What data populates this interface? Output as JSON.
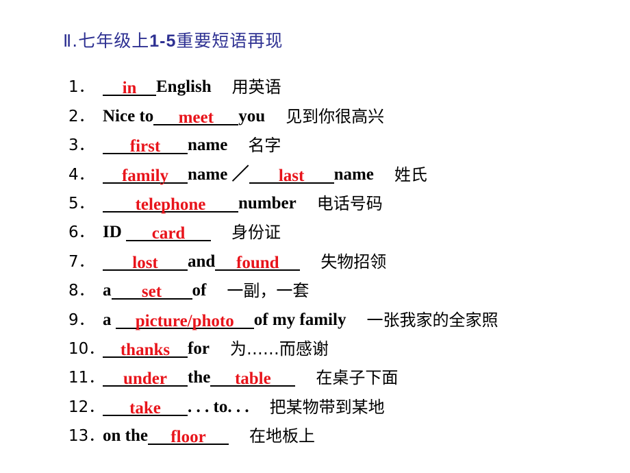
{
  "title": {
    "prefix": "Ⅱ.七年级上",
    "bold_part": "1-5",
    "suffix": "重要短语再现"
  },
  "colors": {
    "title": "#2e3192",
    "answer": "#e8141b",
    "text": "#000000"
  },
  "items": [
    {
      "num": "1．",
      "parts": [
        {
          "blank": "in"
        },
        {
          "text": "English"
        }
      ],
      "zh": "用英语"
    },
    {
      "num": "2．",
      "parts": [
        {
          "text": "Nice to"
        },
        {
          "blank": "meet"
        },
        {
          "text": "you"
        }
      ],
      "zh": "见到你很高兴"
    },
    {
      "num": "3．",
      "parts": [
        {
          "blank": "first"
        },
        {
          "text": "name"
        }
      ],
      "zh": "名字"
    },
    {
      "num": "4．",
      "parts": [
        {
          "blank": "family"
        },
        {
          "text": "name ／"
        },
        {
          "blank": "last"
        },
        {
          "text": "name"
        }
      ],
      "zh": "姓氏"
    },
    {
      "num": "5．",
      "parts": [
        {
          "blank": "telephone"
        },
        {
          "text": "number"
        }
      ],
      "zh": "电话号码"
    },
    {
      "num": "6．",
      "parts": [
        {
          "text": "ID "
        },
        {
          "blank": "card"
        }
      ],
      "zh": "身份证"
    },
    {
      "num": "7．",
      "parts": [
        {
          "blank": "lost"
        },
        {
          "text": "and"
        },
        {
          "blank": "found"
        }
      ],
      "zh": "失物招领"
    },
    {
      "num": "8．",
      "parts": [
        {
          "text": "a"
        },
        {
          "blank": "set"
        },
        {
          "text": "of"
        }
      ],
      "zh": "一副，一套"
    },
    {
      "num": "9．",
      "parts": [
        {
          "text": "a "
        },
        {
          "blank": "picture/photo"
        },
        {
          "text": "of my family"
        }
      ],
      "zh": "一张我家的全家照"
    },
    {
      "num": "10．",
      "parts": [
        {
          "blank": "thanks"
        },
        {
          "text": "for"
        }
      ],
      "zh": "为……而感谢"
    },
    {
      "num": "11．",
      "parts": [
        {
          "blank": "under"
        },
        {
          "text": "the"
        },
        {
          "blank": "table"
        }
      ],
      "zh": "在桌子下面"
    },
    {
      "num": "12．",
      "parts": [
        {
          "blank": "take"
        },
        {
          "text": ". . . to. . ."
        }
      ],
      "zh": "把某物带到某地"
    },
    {
      "num": "13．",
      "parts": [
        {
          "text": "on the"
        },
        {
          "blank": "floor"
        }
      ],
      "zh": "在地板上"
    }
  ]
}
